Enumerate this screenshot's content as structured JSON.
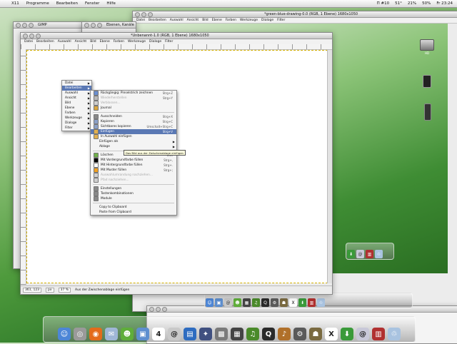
{
  "menubar": {
    "items": [
      "X11",
      "Programme",
      "Bearbeiten",
      "Fenster",
      "Hilfe"
    ],
    "status": [
      "Π #10",
      "51°",
      "21%",
      "50%",
      "Fr 23:24"
    ]
  },
  "windows": {
    "gimp": {
      "title": "GIMP"
    },
    "ebenen": {
      "title": "Ebenen, Kanäle"
    },
    "green": {
      "title": "*green-blue-drawing-0.0 (RGB, 1 Ebene) 1680x1050",
      "menu": [
        "Datei",
        "Bearbeiten",
        "Auswahl",
        "Ansicht",
        "Bild",
        "Ebene",
        "Farben",
        "Werkzeuge",
        "Dialoge",
        "Filter"
      ]
    },
    "main": {
      "title": "*Unbenannt-1.0 (RGB, 1 Ebene) 1680x1050",
      "menu": [
        "Datei",
        "Bearbeiten",
        "Auswahl",
        "Ansicht",
        "Bild",
        "Ebene",
        "Farben",
        "Werkzeuge",
        "Dialoge",
        "Filter"
      ],
      "status": {
        "coords": "361, 123",
        "unit": "px",
        "zoom": "37 %",
        "message": "Aus der Zwischenablage einfügen"
      }
    },
    "terminal": {
      "title": "Terminal"
    }
  },
  "menus": {
    "image_menu": [
      {
        "label": "Datei",
        "arrow": true
      },
      {
        "label": "Bearbeiten",
        "arrow": true,
        "selected": true
      },
      {
        "label": "Auswahl",
        "arrow": true
      },
      {
        "label": "Ansicht",
        "arrow": true
      },
      {
        "label": "Bild",
        "arrow": true
      },
      {
        "label": "Ebene",
        "arrow": true
      },
      {
        "label": "Farben",
        "arrow": true
      },
      {
        "label": "Werkzeuge",
        "arrow": true
      },
      {
        "label": "Dialoge",
        "arrow": true
      },
      {
        "label": "Filter",
        "arrow": true
      }
    ],
    "edit_menu": [
      {
        "label": "Rückgängig: Pinselstrich zeichnen",
        "shortcut": "Strg+Z",
        "icon": "undo-icon",
        "color": "#6a8fd0"
      },
      {
        "label": "Wiederherstellen",
        "shortcut": "Strg+Y",
        "icon": "redo-icon",
        "color": "#b8b8b8",
        "disabled": true
      },
      {
        "label": "Verblassen...",
        "icon": "fade-icon",
        "color": "#cfcfcf",
        "disabled": true
      },
      {
        "label": "Journal",
        "icon": "journal-icon",
        "color": "#d9a640"
      },
      {
        "sep": true
      },
      {
        "label": "Ausschneiden",
        "shortcut": "Strg+X",
        "icon": "cut-icon",
        "color": "#888888"
      },
      {
        "label": "Kopieren",
        "shortcut": "Strg+C",
        "icon": "copy-icon",
        "color": "#8aa0c8"
      },
      {
        "label": "Sichtbares kopieren",
        "shortcut": "Umschalt+Strg+C",
        "icon": "copy-visible-icon",
        "color": "#8aa0c8"
      },
      {
        "label": "Einfügen",
        "shortcut": "Strg+V",
        "icon": "paste-icon",
        "color": "#e0b050",
        "selected": true
      },
      {
        "label": "In Auswahl einfügen",
        "icon": "paste-into-icon",
        "color": "#e0b050"
      },
      {
        "label": "Einfügen als",
        "arrow": true
      },
      {
        "label": "Ablage",
        "arrow": true
      },
      {
        "sep": true
      },
      {
        "label": "Löschen",
        "shortcut": "Entf",
        "icon": "clear-icon",
        "color": "#6fb04a"
      },
      {
        "label": "Mit Vordergrundfarbe füllen",
        "shortcut": "Strg+,",
        "icon": "fill-fg-icon",
        "color": "#000000"
      },
      {
        "label": "Mit Hintergrundfarbe füllen",
        "shortcut": "Strg+.",
        "icon": "fill-bg-icon",
        "color": "#ffffff"
      },
      {
        "label": "Mit Muster füllen",
        "shortcut": "Strg+;",
        "icon": "fill-pattern-icon",
        "color": "#f0a020"
      },
      {
        "label": "Auswahlumrandung nachziehen...",
        "icon": "stroke-selection-icon",
        "color": "#cfcfcf",
        "disabled": true
      },
      {
        "label": "Pfad nachziehen...",
        "icon": "stroke-path-icon",
        "color": "#cfcfcf",
        "disabled": true
      },
      {
        "sep": true
      },
      {
        "label": "Einstellungen",
        "icon": "preferences-icon",
        "color": "#8a8a8a"
      },
      {
        "label": "Tastenkombinationen",
        "icon": "keyboard-icon",
        "color": "#8a8a8a"
      },
      {
        "label": "Module",
        "icon": "modules-icon",
        "color": "#8a8a8a"
      },
      {
        "sep": true
      },
      {
        "label": "Copy to Clipboard"
      },
      {
        "label": "Paste from Clipboard"
      }
    ],
    "tooltip": "Das Bild aus der Zwischenablage einfügen"
  },
  "dock": {
    "icons": [
      {
        "name": "finder-icon",
        "color": "#4d86d6",
        "glyph": "☺"
      },
      {
        "name": "system-preferences-icon",
        "color": "#9a9a9a",
        "glyph": "◎"
      },
      {
        "name": "firefox-icon",
        "color": "#e36b1a",
        "glyph": "◉"
      },
      {
        "name": "mail-icon",
        "color": "#9fb6d6",
        "glyph": "✉"
      },
      {
        "name": "ichat-icon",
        "color": "#5fae3a",
        "glyph": "☻"
      },
      {
        "name": "image-icon",
        "color": "#5e8fcf",
        "glyph": "▣"
      },
      {
        "name": "ical-icon",
        "color": "#ffffff",
        "glyph": "4"
      },
      {
        "name": "address-book-icon",
        "color": "#c9c9c9",
        "glyph": "@"
      },
      {
        "name": "preview-icon",
        "color": "#2e6cc0",
        "glyph": "▤"
      },
      {
        "name": "dashboard-icon",
        "color": "#405080",
        "glyph": "✦"
      },
      {
        "name": "photo-icon",
        "color": "#7a7a7a",
        "glyph": "▩"
      },
      {
        "name": "film-icon",
        "color": "#444444",
        "glyph": "▦"
      },
      {
        "name": "music-icon",
        "color": "#4a8a2a",
        "glyph": "♫"
      },
      {
        "name": "quicktime-icon",
        "color": "#2a2a2a",
        "glyph": "Q"
      },
      {
        "name": "guitar-icon",
        "color": "#b0702a",
        "glyph": "♪"
      },
      {
        "name": "utility-icon",
        "color": "#5a5a5a",
        "glyph": "⚙"
      },
      {
        "name": "gimp-icon",
        "color": "#7a6a40",
        "glyph": "☗"
      },
      {
        "name": "x11-icon",
        "color": "#ffffff",
        "glyph": "X"
      },
      {
        "name": "download-icon",
        "color": "#3a9a3a",
        "glyph": "⬇"
      },
      {
        "name": "network-icon",
        "color": "#c8c8d8",
        "glyph": "@"
      },
      {
        "name": "calendar-icon",
        "color": "#b03030",
        "glyph": "▥"
      },
      {
        "name": "trash-icon",
        "color": "#a9c3e0",
        "glyph": "♲"
      }
    ]
  },
  "desktop": {
    "icons": [
      {
        "name": "hard-drive-icon",
        "label": "HD"
      },
      {
        "name": "ipod-icon",
        "label": ""
      },
      {
        "name": "phone-icon",
        "label": ""
      }
    ]
  }
}
